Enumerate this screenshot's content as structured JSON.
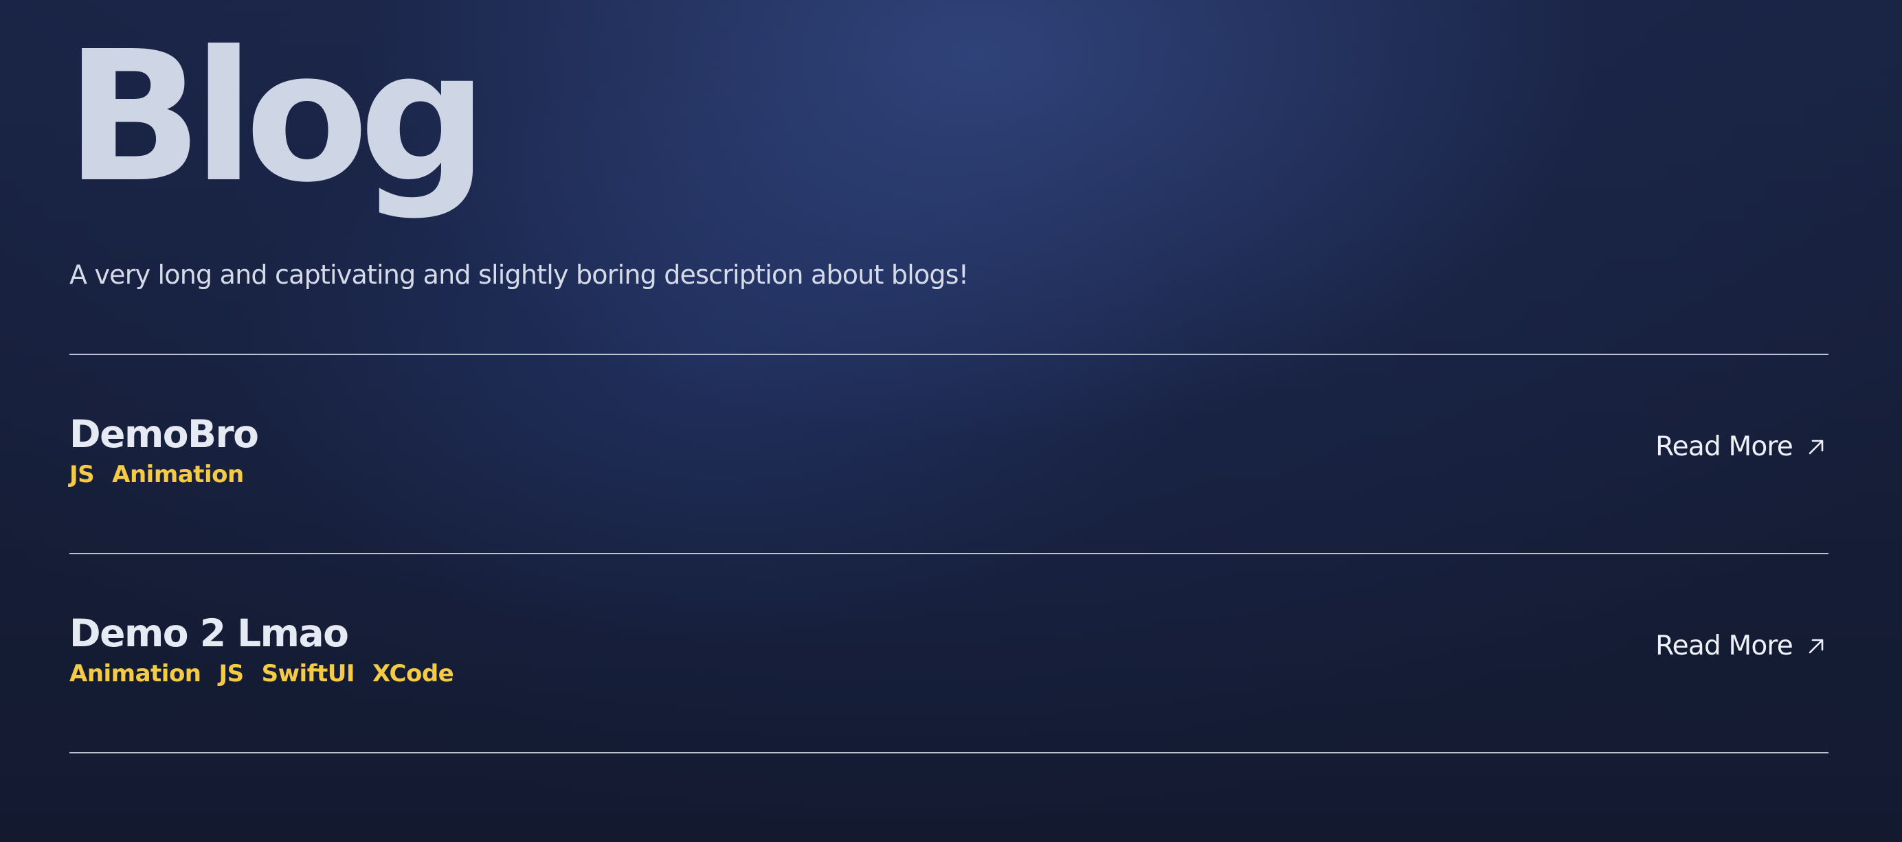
{
  "header": {
    "title": "Blog",
    "description": "A very long and captivating and slightly boring description about blogs!"
  },
  "posts": [
    {
      "title": "DemoBro",
      "tags": [
        "JS",
        "Animation"
      ],
      "read_more_label": "Read More",
      "read_more_icon": "arrow-up-right-icon"
    },
    {
      "title": "Demo 2 Lmao",
      "tags": [
        "Animation",
        "JS",
        "SwiftUI",
        "XCode"
      ],
      "read_more_label": "Read More",
      "read_more_icon": "arrow-up-right-icon"
    }
  ],
  "colors": {
    "background": "#161e38",
    "background_glow": "#384e8c",
    "title_text": "#ced6e6",
    "body_text": "#d6dbe8",
    "tag_accent": "#f5cb45",
    "divider": "#cfd5e2"
  }
}
